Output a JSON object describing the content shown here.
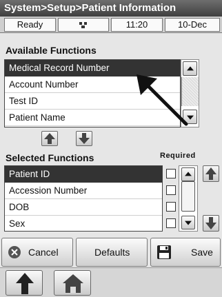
{
  "header": {
    "title": "System>Setup>Patient Information"
  },
  "status": {
    "state": "Ready",
    "time": "11:20",
    "date": "10-Dec"
  },
  "available": {
    "label": "Available Functions",
    "items": [
      "Medical Record Number",
      "Account Number",
      "Test ID",
      "Patient Name"
    ]
  },
  "selected": {
    "label": "Selected Functions",
    "required_label": "Required",
    "items": [
      "Patient ID",
      "Accession Number",
      "DOB",
      "Sex"
    ]
  },
  "actions": {
    "cancel": "Cancel",
    "defaults": "Defaults",
    "save": "Save"
  },
  "colors": {
    "title_bg": "#4a4a4a",
    "selected_row": "#333333",
    "arrow": "#111111"
  }
}
